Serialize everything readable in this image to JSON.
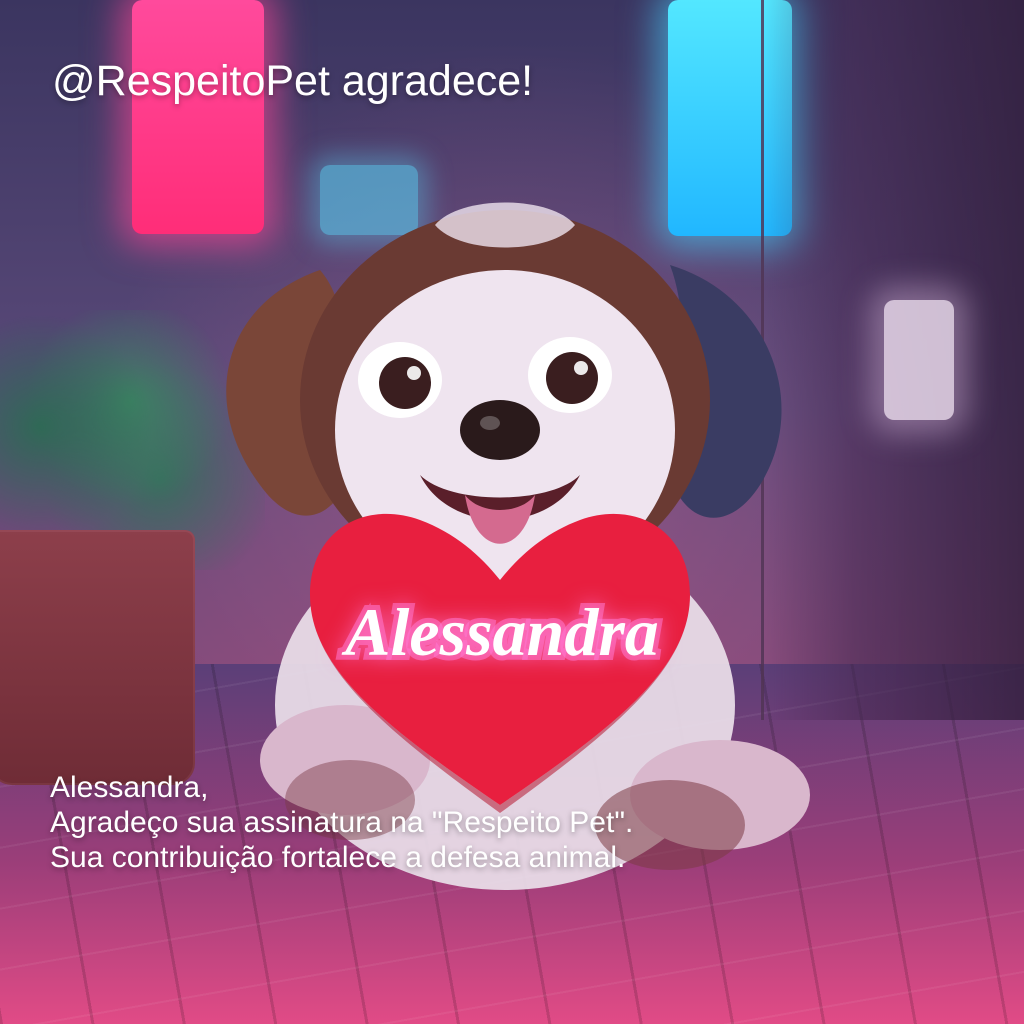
{
  "title": "@RespeitoPet agradece!",
  "heart_sign_text": "Alessandra",
  "message": {
    "line1": "Alessandra,",
    "line2": "Agradeço sua assinatura na \"Respeito Pet\".",
    "line3": "Sua contribuição fortalece a defesa animal."
  },
  "colors": {
    "text": "#ffffff",
    "heart": "#e81f3f",
    "heart_shadow": "#b5152f",
    "neon_pink": "#ff2d78",
    "neon_cyan": "#21b7ff",
    "puppy_brown": "#7a4638",
    "puppy_fur": "#efe4ef"
  },
  "icons": {
    "puppy": "puppy-illustration",
    "heart": "heart-sign"
  }
}
